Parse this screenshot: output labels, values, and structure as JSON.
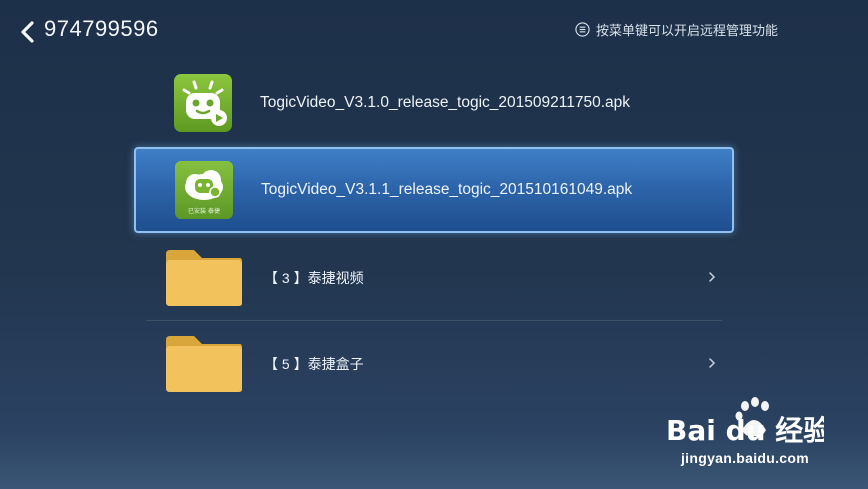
{
  "header": {
    "title": "974799596",
    "hint": "按菜单键可以开启远程管理功能"
  },
  "files": [
    {
      "name": "TogicVideo_V3.1.0_release_togic_201509211750.apk",
      "selected": false
    },
    {
      "name": "TogicVideo_V3.1.1_release_togic_201510161049.apk",
      "selected": true,
      "icon_caption": "已安装 泰捷"
    }
  ],
  "folders": [
    {
      "name": "【 3 】泰捷视频"
    },
    {
      "name": "【 5 】泰捷盒子"
    }
  ],
  "watermark": {
    "brand": "Bai du 经验",
    "url": "jingyan.baidu.com"
  },
  "colors": {
    "background": "#22364f",
    "selection": "#2c63a8",
    "apk_green": "#7ab531",
    "folder": "#f0c05a"
  },
  "icons": [
    "back-arrow-icon",
    "menu-icon",
    "apk-app-icon",
    "folder-icon",
    "chevron-right-icon"
  ]
}
